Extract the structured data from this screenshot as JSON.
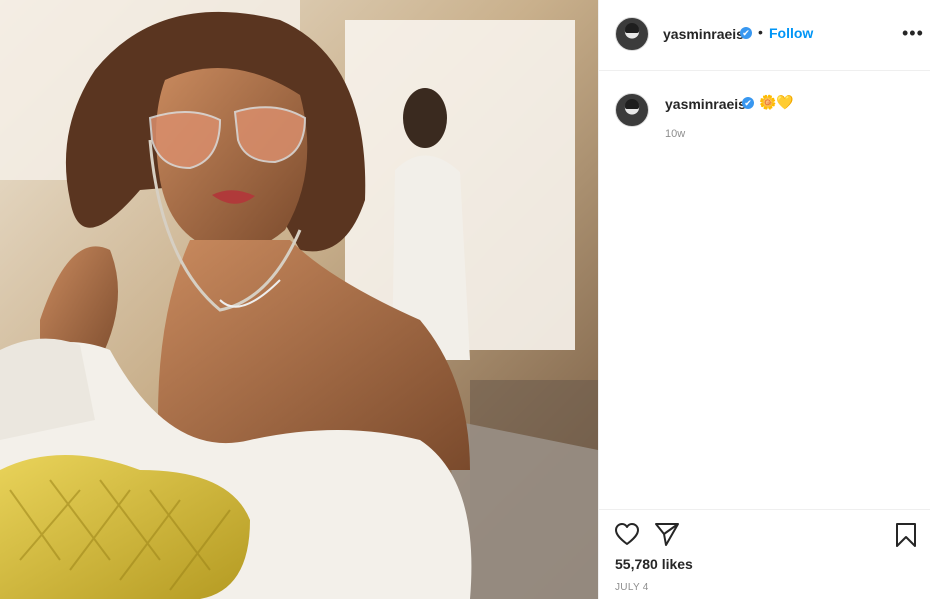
{
  "post": {
    "username": "yasminraeis",
    "verified_mark": "✔",
    "separator": "•",
    "follow_label": "Follow",
    "more_label": "•••",
    "caption": {
      "username": "yasminraeis",
      "emoji": "🌼💛",
      "time_ago": "10w"
    },
    "likes": "55,780 likes",
    "date": "JULY 4"
  },
  "icons": {
    "like": "heart-icon",
    "share": "paper-plane-icon",
    "save": "bookmark-icon",
    "more": "more-options-icon"
  },
  "colors": {
    "accent": "#0095f6",
    "verified": "#3897f0",
    "muted": "#8e8e8e",
    "text": "#262626"
  }
}
